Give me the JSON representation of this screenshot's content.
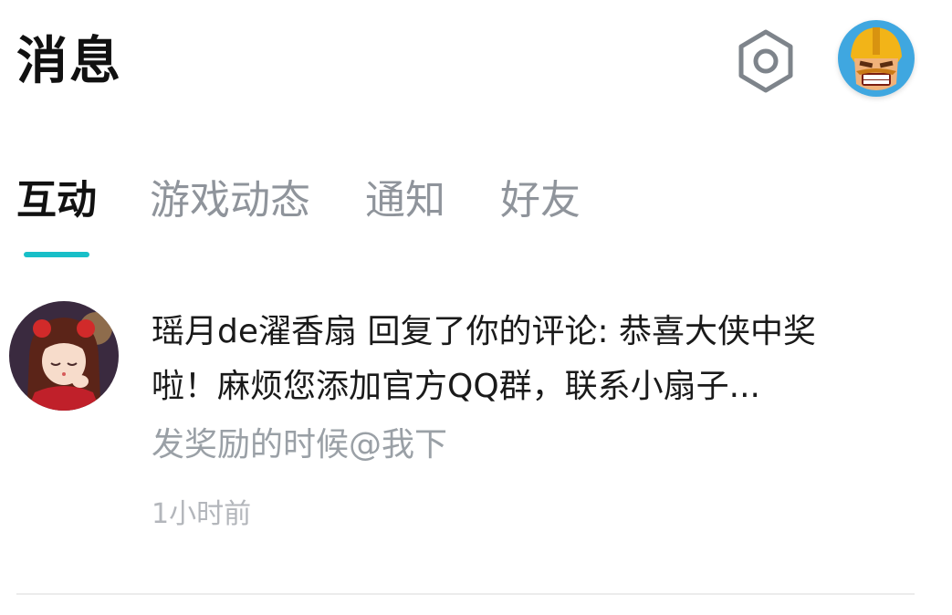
{
  "header": {
    "title": "消息"
  },
  "tabs": [
    {
      "label": "互动",
      "active": true
    },
    {
      "label": "游戏动态",
      "active": false
    },
    {
      "label": "通知",
      "active": false
    },
    {
      "label": "好友",
      "active": false
    }
  ],
  "messages": [
    {
      "user": "瑶月de濯香扇",
      "line1": "瑶月de濯香扇 回复了你的评论: 恭喜大侠中奖",
      "line2": "啦！麻烦您添加官方QQ群，联系小扇子...",
      "quote": "发奖励的时候@我下",
      "time": "1小时前"
    }
  ],
  "colors": {
    "accent": "#18bfc8",
    "text_primary": "#111111",
    "text_secondary": "#8f949b",
    "divider": "#ececec"
  },
  "icons": {
    "settings": "hexagon-gear-icon",
    "user_avatar": "avatar",
    "message_avatar": "avatar"
  }
}
